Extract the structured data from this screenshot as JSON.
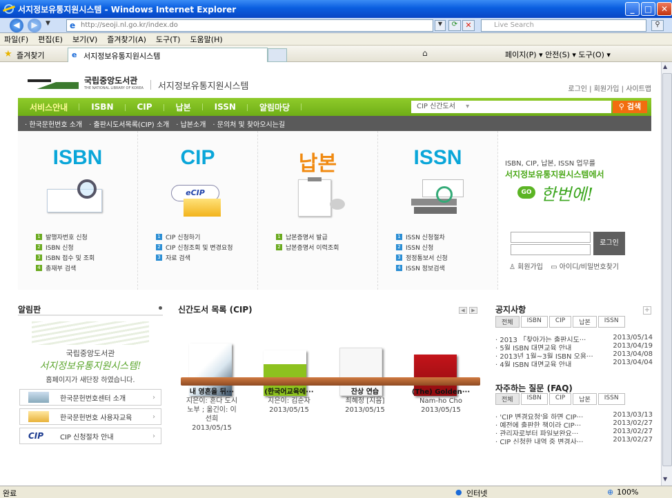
{
  "window": {
    "title": "서지정보유통지원시스템 - Windows Internet Explorer"
  },
  "address": {
    "url": "http://seoji.nl.go.kr/index.do",
    "search_placeholder": "Live Search"
  },
  "menubar": [
    "파일(F)",
    "편집(E)",
    "보기(V)",
    "즐겨찾기(A)",
    "도구(T)",
    "도움말(H)"
  ],
  "favbar": {
    "favorites": "즐겨찾기",
    "tab_title": "서지정보유통지원시스템",
    "tools": "페이지(P) ▾   안전(S) ▾   도구(O) ▾"
  },
  "statusbar": {
    "left": "완료",
    "zone": "인터넷",
    "zoom": "100%"
  },
  "header": {
    "logo_kor": "국립중앙도서관",
    "logo_eng": "THE NATIONAL LIBRARY OF KOREA",
    "system_title": "서지정보유통지원시스템",
    "toplinks": "로그인 | 회원가입 | 사이트맵"
  },
  "gnb": {
    "items": [
      "서비스안내",
      "ISBN",
      "CIP",
      "납본",
      "ISSN",
      "알림마당"
    ],
    "search_select": "CIP 신간도서",
    "search_button": "검색"
  },
  "subnav": [
    "· 한국문헌번호 소개",
    "· 출판시도서목록(CIP) 소개",
    "· 납본소개",
    "· 문의처 및 찾아오시는길"
  ],
  "services": [
    {
      "title": "ISBN",
      "items": [
        "발행자번호 신청",
        "ISBN 신청",
        "ISBN 접수 및 조회",
        "총재부 검색"
      ]
    },
    {
      "title": "CIP",
      "items": [
        "CIP 신청하기",
        "CIP 신청조회 및 변경요청",
        "자료 검색"
      ]
    },
    {
      "title": "납본",
      "items": [
        "납본증명서 발급",
        "납본증명서 이력조회"
      ]
    },
    {
      "title": "ISSN",
      "items": [
        "ISSN 신청절차",
        "ISSN 신청",
        "정정통보서 신청",
        "ISSN 정보검색"
      ]
    }
  ],
  "promo": {
    "line1": "ISBN, CIP, 납본, ISSN 업무를",
    "line2": "서지정보유통지원시스템에서",
    "go": "GO",
    "script": "한번에!",
    "login_button": "로그인",
    "join": "회원가입",
    "find": "아이디/비밀번호찾기"
  },
  "board": {
    "title": "알림판",
    "banner_line1": "국립중앙도서관",
    "banner_line2": "서지정보유통지원시스템!",
    "banner_line3": "홈페이지가 새단장 하였습니다.",
    "links": [
      "한국문헌번호센터 소개",
      "한국문헌번호 사용자교육",
      "CIP 신청절차 안내"
    ],
    "cip_logo": "CIP"
  },
  "new_books": {
    "title": "신간도서 목록 (CIP)",
    "books": [
      {
        "title": "내 영혼을 뒤···",
        "author": "지은이: 혼다 도시",
        "author2": "노부 ; 옮긴이: 이",
        "author3": "선희",
        "date": "2013/05/15"
      },
      {
        "title": "(한국어교육에···",
        "author": "지은이: 김순자",
        "date": "2013/05/15"
      },
      {
        "title": "잔상 연습",
        "author": "최혜정 [지음]",
        "date": "2013/05/15"
      },
      {
        "title": "(The) Golden···",
        "author": "Nam-ho Cho",
        "date": "2013/05/15"
      }
    ]
  },
  "notice": {
    "title": "공지사항",
    "tabs": [
      "전체",
      "ISBN",
      "CIP",
      "납본",
      "ISSN"
    ],
    "items": [
      {
        "text": "· 2013 「찾아가는 출판시도···",
        "date": "2013/05/14"
      },
      {
        "text": "· 5월 ISBN 대면교육 안내",
        "date": "2013/04/19"
      },
      {
        "text": "· 2013년 1월~3월 ISBN 오용···",
        "date": "2013/04/08"
      },
      {
        "text": "· 4월 ISBN 대면교육 안내",
        "date": "2013/04/04"
      }
    ]
  },
  "faq": {
    "title": "자주하는 질문 (FAQ)",
    "tabs": [
      "전체",
      "ISBN",
      "CIP",
      "납본",
      "ISSN"
    ],
    "items": [
      {
        "text": "· 'CIP 변경요청'을 하면 CIP···",
        "date": "2013/03/13"
      },
      {
        "text": "· 예전에 출판한 책이라 CIP···",
        "date": "2013/02/27"
      },
      {
        "text": "· 관리자로부터 파일보완요···",
        "date": "2013/02/27"
      },
      {
        "text": "· CIP 신청한 내역 중 변경사···",
        "date": "2013/02/27"
      }
    ]
  }
}
